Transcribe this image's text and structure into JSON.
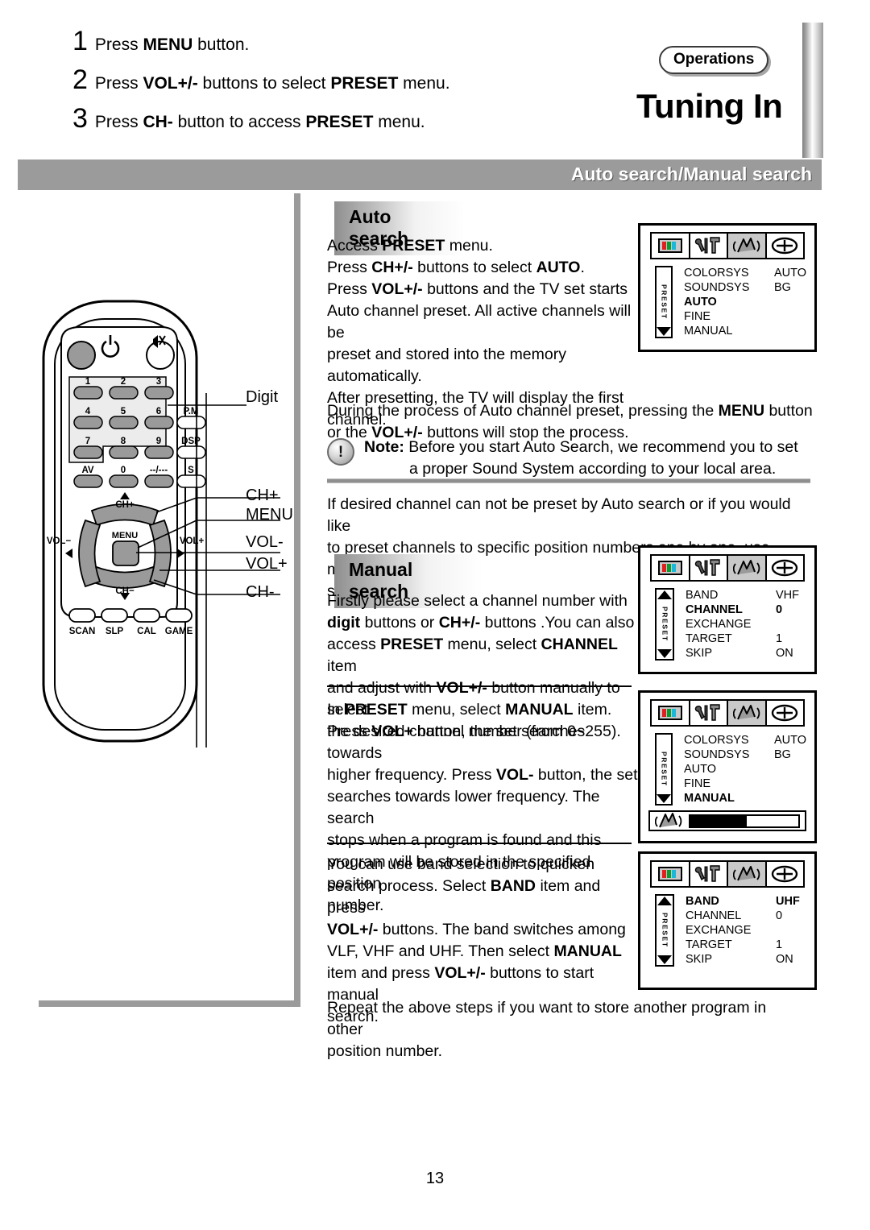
{
  "steps": [
    {
      "num": "1",
      "text_html": "Press <b>MENU</b> button."
    },
    {
      "num": "2",
      "text_html": "Press <b>VOL+/-</b> buttons to select <b>PRESET</b> menu."
    },
    {
      "num": "3",
      "text_html": "Press <b>CH-</b> button to access <b>PRESET</b> menu."
    }
  ],
  "header": {
    "section_tag": "Operations",
    "title": "Tuning In",
    "banner": "Auto search/Manual search"
  },
  "sections": {
    "auto_title": "Auto search",
    "manual_title": "Manual search"
  },
  "paragraphs": {
    "auto_intro": "Access <b>PRESET</b> menu.<br>Press <b>CH+/-</b> buttons to select <b>AUTO</b>.<br>Press <b>VOL+/-</b> buttons and the TV set starts<br>Auto channel preset. All active channels will be<br>preset and stored into the memory automatically.<br>After presetting, the TV will display the first<br>channel.",
    "during": "During the process of Auto channel preset, pressing the <b>MENU</b> button<br>or the <b>VOL+/-</b> buttons will stop the process.",
    "if_desired": "If desired channel can not be preset by Auto search or if you would like<br>to preset channels to specific position numbers one by one, use manual<br>search function.",
    "firstly": "Firstly please select a channel number with<br><b>digit</b> buttons or <b>CH+/-</b> buttons .You can also<br>access <b>PRESET</b> menu, select <b>CHANNEL</b> item<br>and adjust with <b>VOL+/-</b> button manually to select<br>the desired channel number (from 0~255).",
    "in_preset": "In <b>PRESET</b> menu, select <b>MANUAL</b> item.<br>Press <b>VOL+</b> button, the set searches towards<br>higher frequency. Press <b>VOL-</b> button, the set<br>searches towards lower frequency. The search<br>stops when a program is found and this<br>program will be stored in the specified position<br>number.",
    "band_sel": "You can use band selection to quicken<br>search process. Select <b>BAND</b> item and press<br><b>VOL+/-</b> buttons. The band switches among<br>VLF, VHF and UHF. Then select <b>MANUAL</b><br>item and press <b>VOL+/-</b> buttons to start manual<br>search.",
    "repeat": "Repeat the above steps if you want to store another program in other<br>position number."
  },
  "note": {
    "icon_char": "!",
    "line1": "<b>Note:</b> Before you start Auto Search, we recommend you to set",
    "line2": "a proper Sound System according to your local area."
  },
  "osd_screens": [
    {
      "name": "preset-auto",
      "selected_icon_index": 2,
      "side_label": "PRESET",
      "rows": [
        {
          "key": "COLORSYS",
          "value": "AUTO",
          "highlight": false
        },
        {
          "key": "SOUNDSYS",
          "value": "BG",
          "highlight": false
        },
        {
          "key": "AUTO",
          "value": "",
          "highlight": true
        },
        {
          "key": "FINE",
          "value": "",
          "highlight": false
        },
        {
          "key": "MANUAL",
          "value": "",
          "highlight": false
        }
      ],
      "arrow_top": "up-hidden",
      "arrow_bottom": "down",
      "meter": null
    },
    {
      "name": "preset-channel",
      "selected_icon_index": 2,
      "side_label": "PRESET",
      "rows": [
        {
          "key": "BAND",
          "value": "VHF",
          "highlight": false
        },
        {
          "key": "CHANNEL",
          "value": "0",
          "highlight": true
        },
        {
          "key": "EXCHANGE",
          "value": "",
          "highlight": false
        },
        {
          "key": "TARGET",
          "value": "1",
          "highlight": false
        },
        {
          "key": "SKIP",
          "value": "ON",
          "highlight": false
        }
      ],
      "arrow_top": "up",
      "arrow_bottom": "down",
      "meter": null
    },
    {
      "name": "preset-manual",
      "selected_icon_index": 2,
      "side_label": "PRESET",
      "rows": [
        {
          "key": "COLORSYS",
          "value": "AUTO",
          "highlight": false
        },
        {
          "key": "SOUNDSYS",
          "value": "BG",
          "highlight": false
        },
        {
          "key": "AUTO",
          "value": "",
          "highlight": false
        },
        {
          "key": "FINE",
          "value": "",
          "highlight": false
        },
        {
          "key": "MANUAL",
          "value": "",
          "highlight": true
        }
      ],
      "arrow_top": "up-hidden",
      "arrow_bottom": "down",
      "meter": {
        "fill_percent": 52
      }
    },
    {
      "name": "preset-band-uhf",
      "selected_icon_index": 2,
      "side_label": "PRESET",
      "rows": [
        {
          "key": "BAND",
          "value": "UHF",
          "highlight": true
        },
        {
          "key": "CHANNEL",
          "value": "0",
          "highlight": false
        },
        {
          "key": "EXCHANGE",
          "value": "",
          "highlight": false
        },
        {
          "key": "TARGET",
          "value": "1",
          "highlight": false
        },
        {
          "key": "SKIP",
          "value": "ON",
          "highlight": false
        }
      ],
      "arrow_top": "up",
      "arrow_bottom": "down",
      "meter": null
    }
  ],
  "remote": {
    "digit_keys": [
      "1",
      "2",
      "3",
      "4",
      "5",
      "6",
      "7",
      "8",
      "9"
    ],
    "bottom_row_keys": [
      "AV",
      "0",
      "--/---"
    ],
    "right_column_keys": [
      "P.M",
      "DSP",
      "S"
    ],
    "function_keys": [
      "SCAN",
      "SLP",
      "CAL",
      "GAME"
    ],
    "pad_labels": {
      "up": "CH+",
      "down": "CH−",
      "left": "VOL−",
      "right": "VOL+",
      "center": "MENU"
    }
  },
  "callouts": [
    {
      "label": "Digit"
    },
    {
      "label": "CH+"
    },
    {
      "label": "MENU"
    },
    {
      "label": "VOL-"
    },
    {
      "label": "VOL+"
    },
    {
      "label": "CH-"
    }
  ],
  "page_number": "13"
}
